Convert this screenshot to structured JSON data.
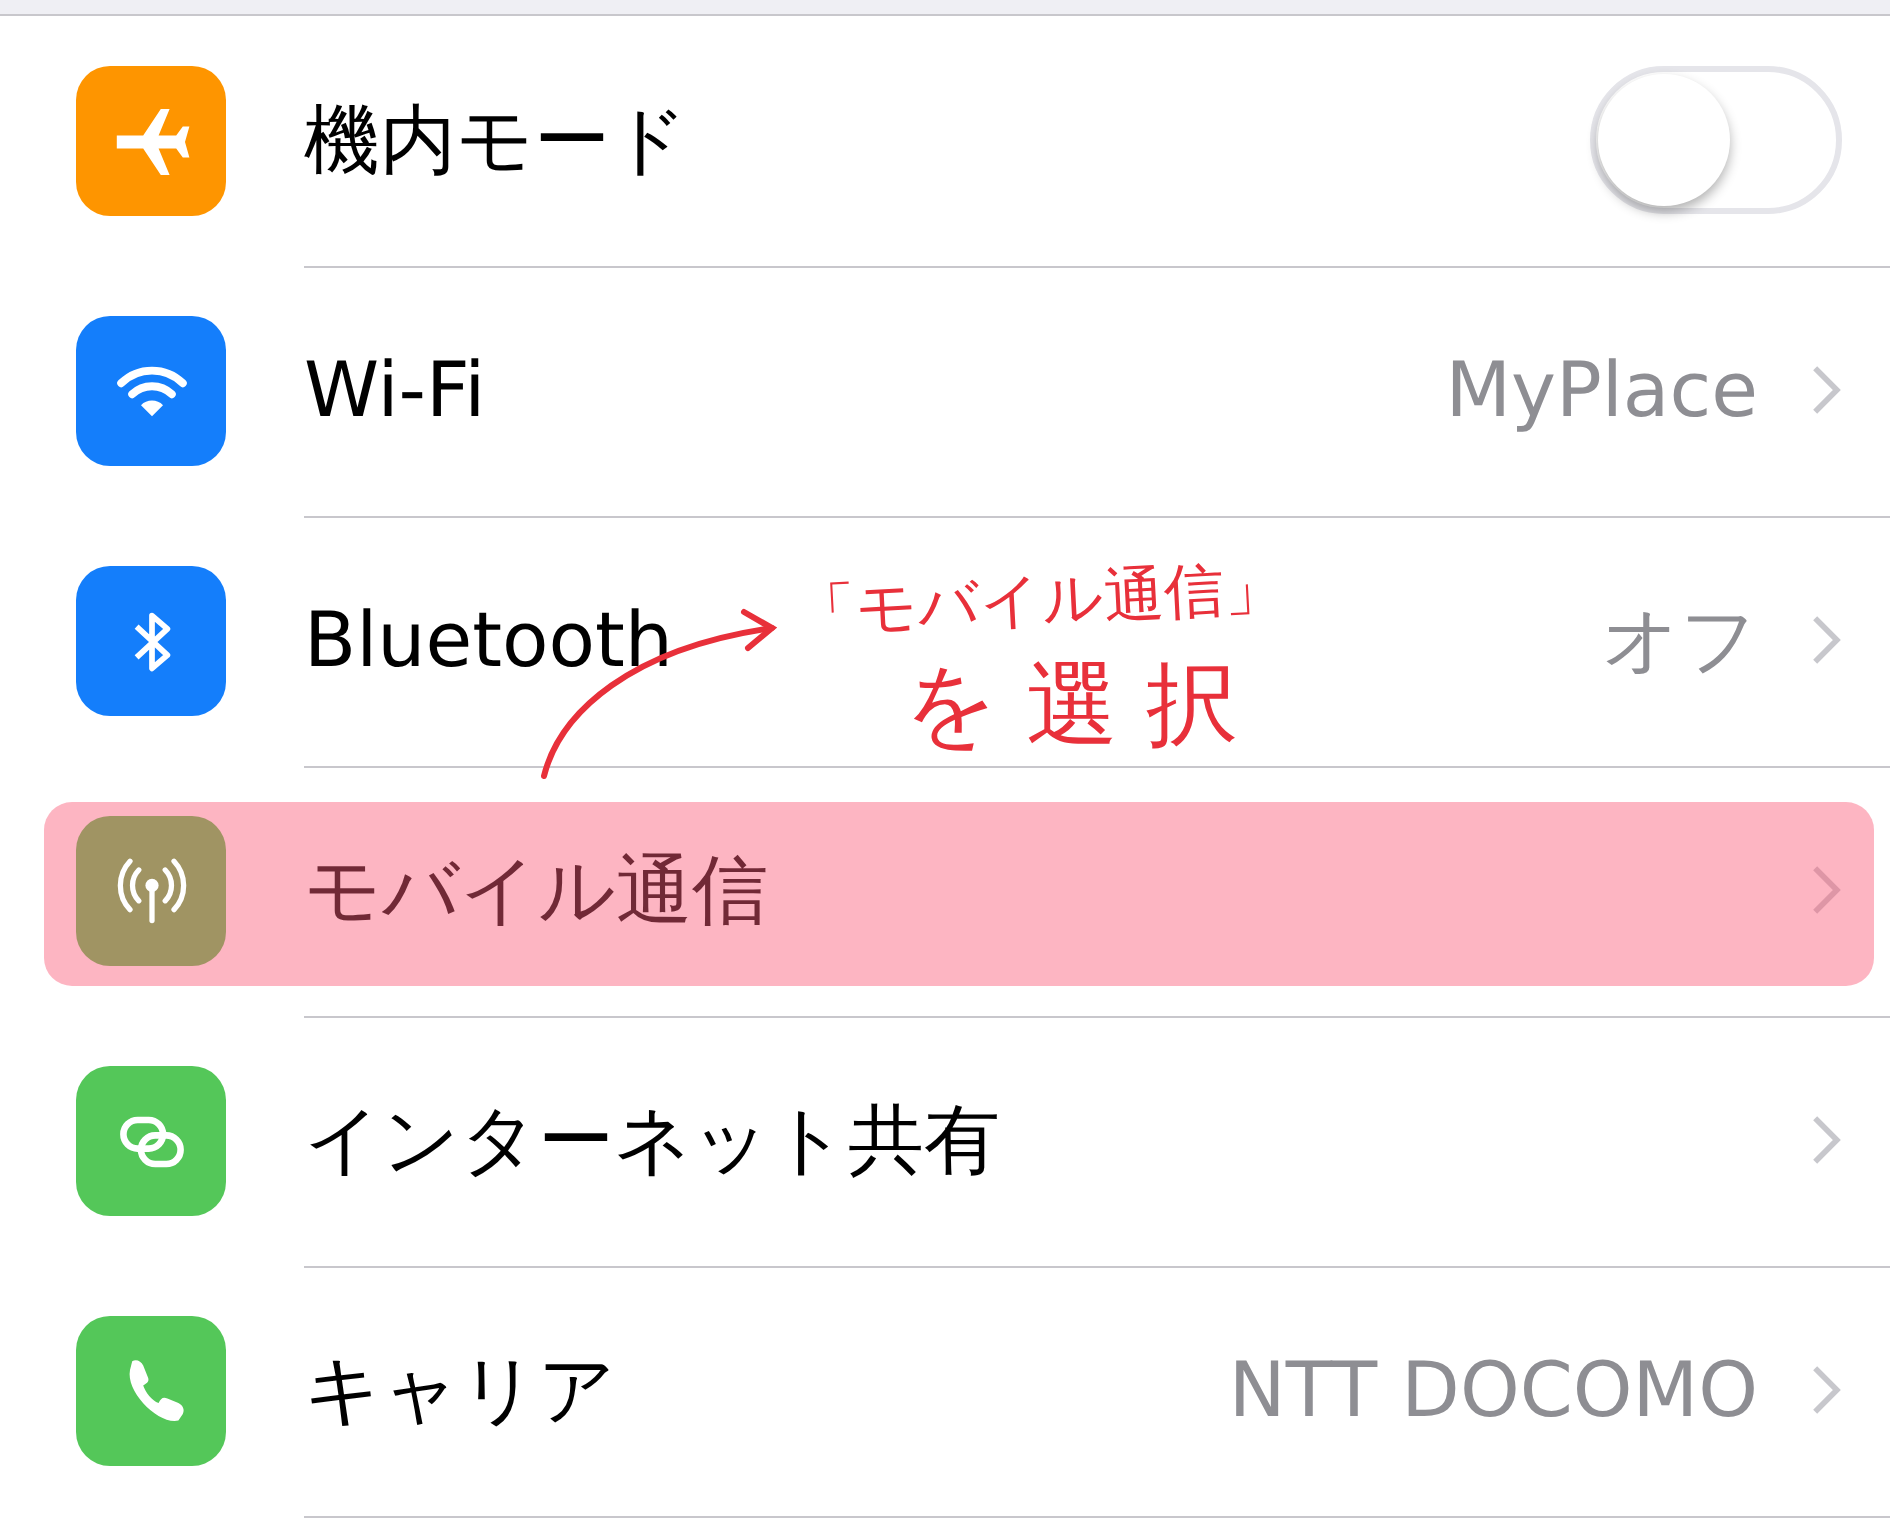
{
  "rows": [
    {
      "kind": "toggle",
      "label": "機内モード",
      "color": "#fe9500",
      "on": false,
      "highlighted": false
    },
    {
      "kind": "link",
      "label": "Wi-Fi",
      "value": "MyPlace",
      "color": "#147efb",
      "highlighted": false
    },
    {
      "kind": "link",
      "label": "Bluetooth",
      "value": "オフ",
      "color": "#147efb",
      "highlighted": false
    },
    {
      "kind": "link",
      "label": "モバイル通信",
      "color": "#a09463",
      "highlighted": true
    },
    {
      "kind": "link",
      "label": "インターネット共有",
      "color": "#54c759",
      "highlighted": false
    },
    {
      "kind": "link",
      "label": "キャリア",
      "value": "NTT DOCOMO",
      "color": "#54c759",
      "highlighted": false
    }
  ],
  "annotation": {
    "lines": [
      "「モバイル通信」",
      "を選択"
    ]
  }
}
